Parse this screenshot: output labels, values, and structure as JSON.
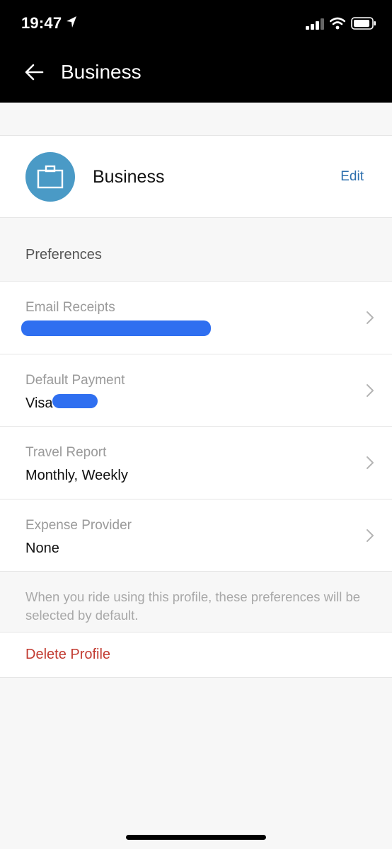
{
  "status_bar": {
    "time": "19:47"
  },
  "nav": {
    "title": "Business"
  },
  "profile": {
    "name": "Business",
    "edit_label": "Edit"
  },
  "preferences": {
    "section_title": "Preferences",
    "items": [
      {
        "label": "Email Receipts",
        "value": ""
      },
      {
        "label": "Default Payment",
        "value": "Visa"
      },
      {
        "label": "Travel Report",
        "value": "Monthly, Weekly"
      },
      {
        "label": "Expense Provider",
        "value": "None"
      }
    ],
    "footer_note": "When you ride using this profile, these preferences will be selected by default."
  },
  "delete_label": "Delete Profile",
  "colors": {
    "accent": "#2d6fae",
    "avatar": "#4a9ac6",
    "danger": "#c23b31",
    "redaction": "#2f6ff0"
  }
}
